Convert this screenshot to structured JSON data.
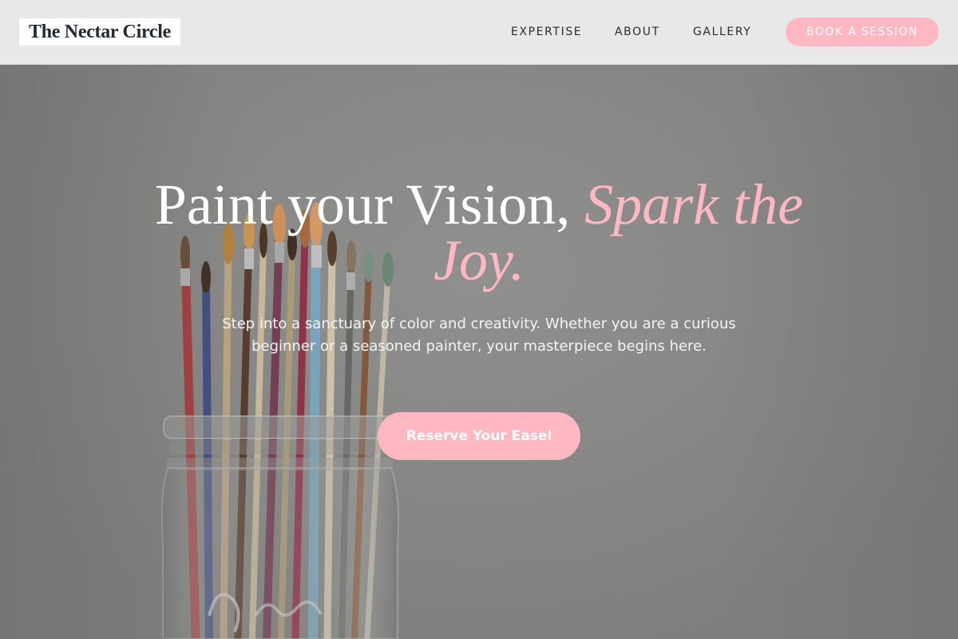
{
  "nav": {
    "logo": "The Nectar Circle",
    "links": [
      "EXPERTISE",
      "ABOUT",
      "GALLERY"
    ],
    "cta": "BOOK A SESSION"
  },
  "hero": {
    "headline_plain": "Paint your Vision, ",
    "headline_accent": "Spark the Joy.",
    "subtext": "Step into a sanctuary of color and creativity. Whether you are a curious beginner or a seasoned painter, your masterpiece begins here.",
    "cta": "Reserve Your Easel",
    "background_image": "paintbrushes-in-glass-jar"
  },
  "colors": {
    "accent_pink": "#ffb8c2",
    "nav_background": "#e8e8e8",
    "logo_text": "#1f2a33",
    "hero_text": "#ffffff"
  }
}
